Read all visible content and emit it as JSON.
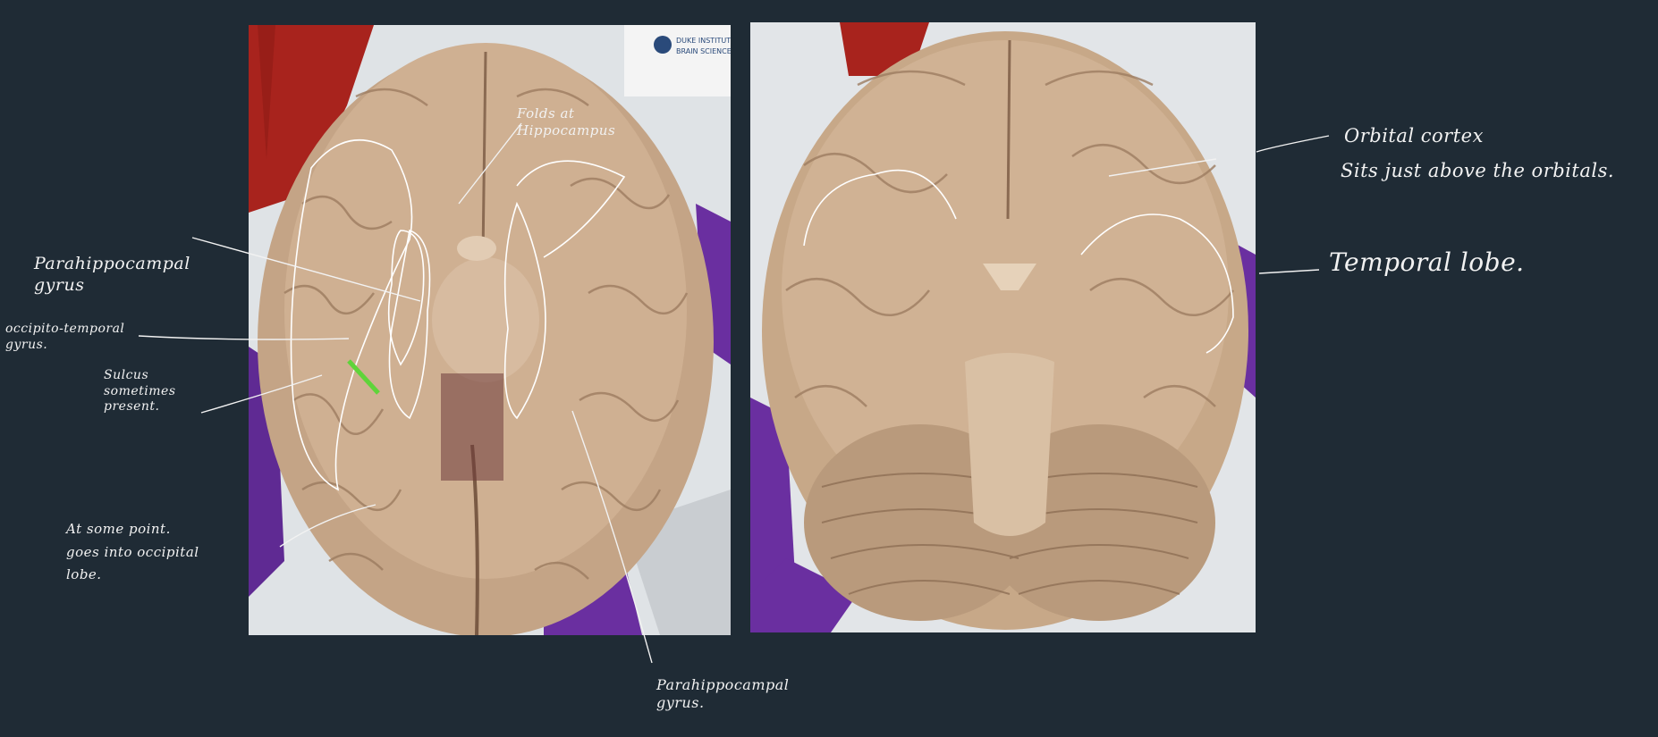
{
  "annotations": {
    "left_photo_fold": "Folds at\nHippocampus",
    "parahippocampal_left": "Parahippocampal\ngyrus",
    "occipito_temporal": "occipito-temporal\ngyrus.",
    "sulcus": "Sulcus\nsometimes\npresent.",
    "occipital": "At some point.\ngoes into occipital\nlobe.",
    "parahippocampal_bottom": "Parahippocampal\ngyrus.",
    "orbital_cortex": "Orbital cortex",
    "orbital_sub": "Sits just above the orbitals.",
    "temporal_lobe": "Temporal lobe."
  },
  "photo_labels": {
    "badge_line1": "DUKE INSTITUTE",
    "badge_line2": "BRAIN SCIENCES"
  },
  "colors": {
    "background": "#1f2b35",
    "ink": "#f2f2f2",
    "highlight": "#5fd43a",
    "brain": "#c9aa8a",
    "glove": "#6a2fa0",
    "cloth": "#b7261f"
  }
}
